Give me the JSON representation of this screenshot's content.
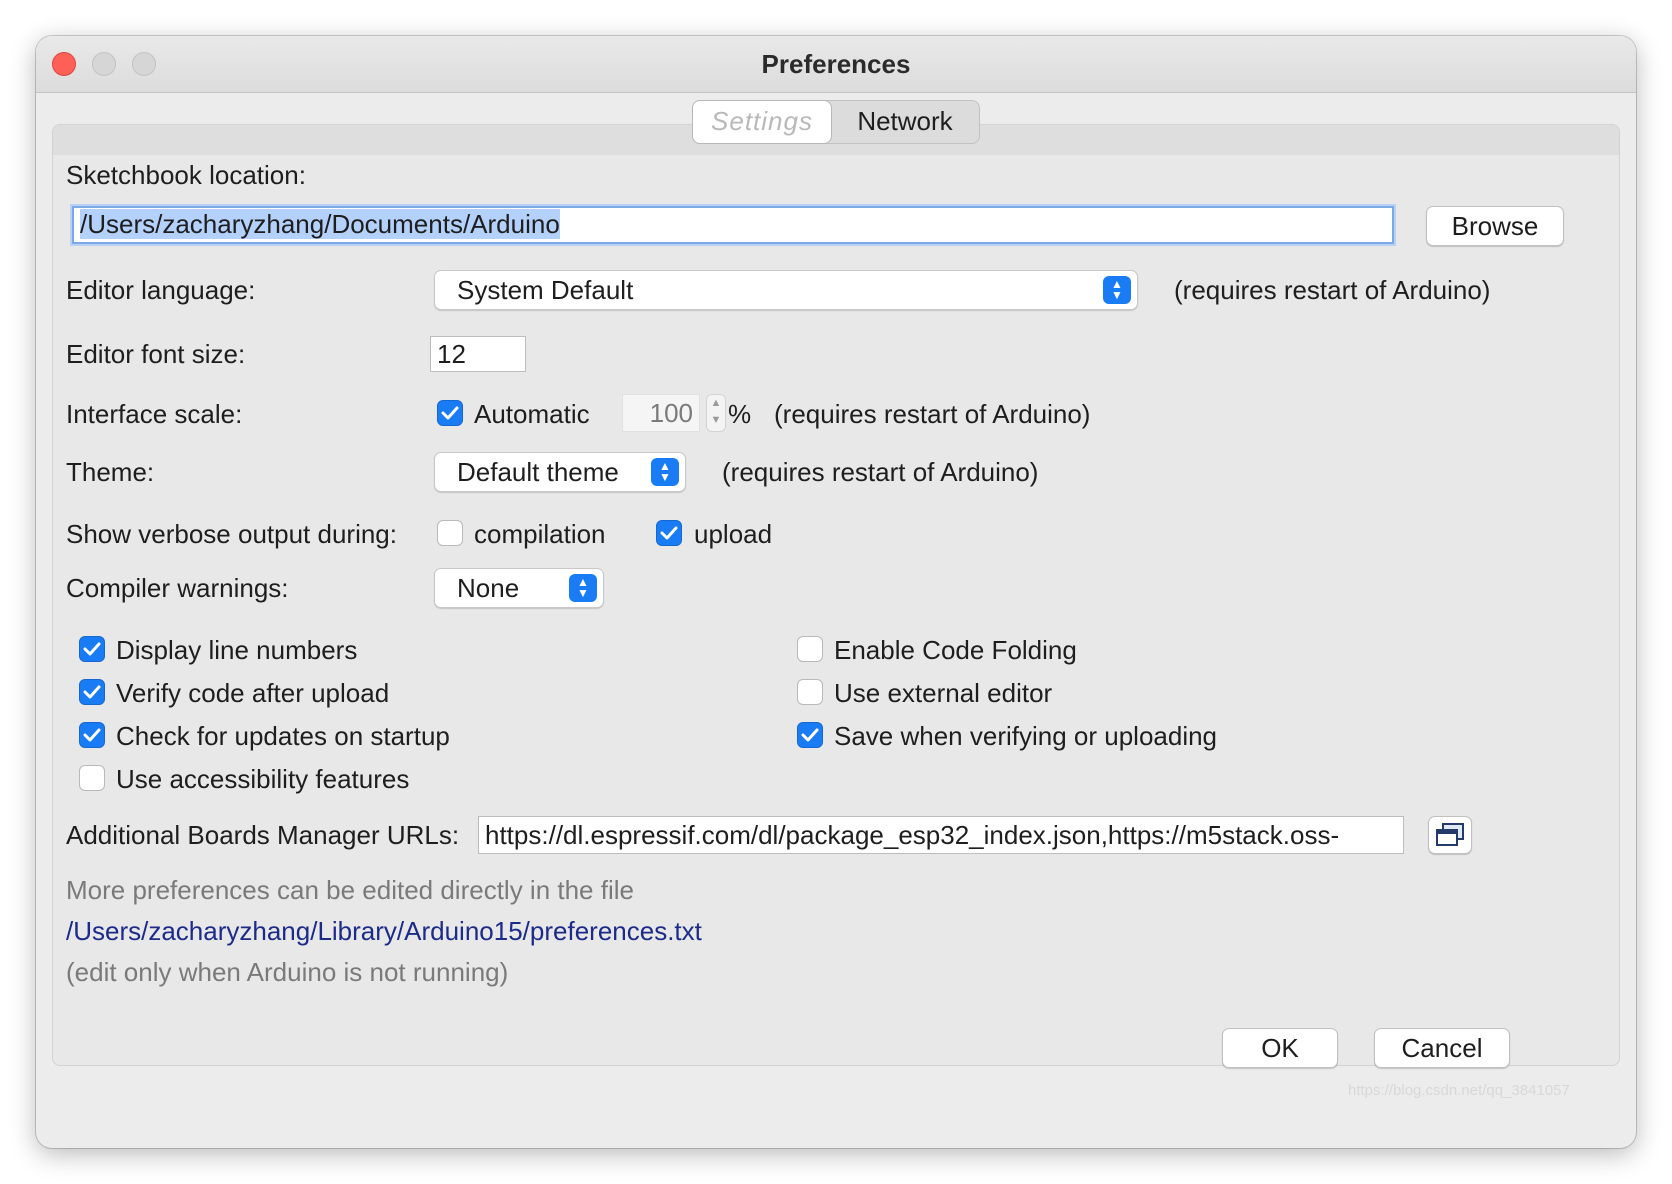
{
  "window": {
    "title": "Preferences"
  },
  "tabs": [
    {
      "label": "Settings",
      "active": true
    },
    {
      "label": "Network",
      "active": false
    }
  ],
  "sketchbook": {
    "label": "Sketchbook location:",
    "value": "/Users/zacharyzhang/Documents/Arduino",
    "browse_label": "Browse"
  },
  "editor_language": {
    "label": "Editor language:",
    "value": "System Default",
    "note": "(requires restart of Arduino)"
  },
  "font_size": {
    "label": "Editor font size:",
    "value": "12"
  },
  "interface_scale": {
    "label": "Interface scale:",
    "automatic_label": "Automatic",
    "automatic_checked": true,
    "value": "100",
    "unit": "%",
    "note": "(requires restart of Arduino)"
  },
  "theme": {
    "label": "Theme:",
    "value": "Default theme",
    "note": "(requires restart of Arduino)"
  },
  "verbose": {
    "label": "Show verbose output during:",
    "compilation_label": "compilation",
    "compilation_checked": false,
    "upload_label": "upload",
    "upload_checked": true
  },
  "compiler_warnings": {
    "label": "Compiler warnings:",
    "value": "None"
  },
  "options": {
    "display_line_numbers": {
      "label": "Display line numbers",
      "checked": true
    },
    "verify_after_upload": {
      "label": "Verify code after upload",
      "checked": true
    },
    "check_updates": {
      "label": "Check for updates on startup",
      "checked": true
    },
    "accessibility": {
      "label": "Use accessibility features",
      "checked": false
    },
    "code_folding": {
      "label": "Enable Code Folding",
      "checked": false
    },
    "external_editor": {
      "label": "Use external editor",
      "checked": false
    },
    "save_when_verifying": {
      "label": "Save when verifying or uploading",
      "checked": true
    }
  },
  "boards_urls": {
    "label": "Additional Boards Manager URLs:",
    "value": "https://dl.espressif.com/dl/package_esp32_index.json,https://m5stack.oss-"
  },
  "footer": {
    "info": "More preferences can be edited directly in the file",
    "path": "/Users/zacharyzhang/Library/Arduino15/preferences.txt",
    "note": "(edit only when Arduino is not running)"
  },
  "buttons": {
    "ok": "OK",
    "cancel": "Cancel"
  },
  "watermark": "https://blog.csdn.net/qq_3841057",
  "colors": {
    "accent": "#1a7cf5",
    "close_light": "#fe5f57",
    "link": "#1c2a8a"
  }
}
